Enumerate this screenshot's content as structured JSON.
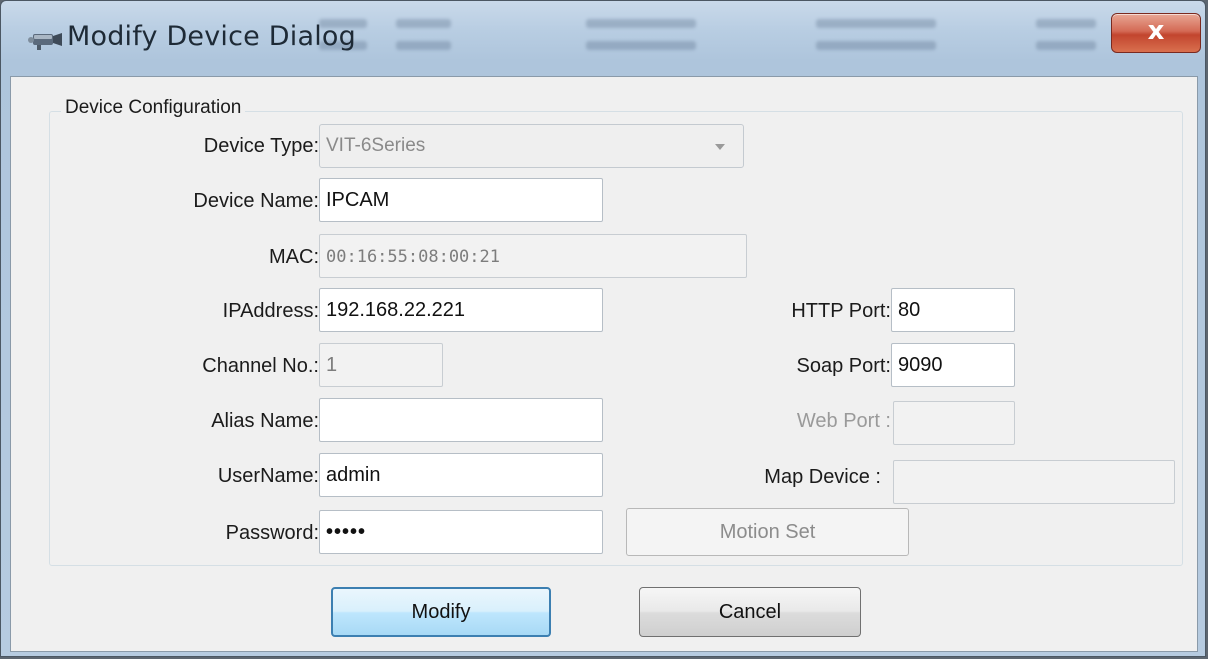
{
  "dialog": {
    "title": "Modify Device Dialog",
    "close_glyph": "x"
  },
  "group": {
    "title": "Device Configuration"
  },
  "fields": {
    "device_type": {
      "label": "Device Type:",
      "value": "VIT-6Series"
    },
    "device_name": {
      "label": "Device Name:",
      "value": "IPCAM"
    },
    "mac": {
      "label": "MAC:",
      "value": "00:16:55:08:00:21"
    },
    "ip_address": {
      "label": "IPAddress:",
      "value": "192.168.22.221"
    },
    "channel_no": {
      "label": "Channel No.:",
      "value": "1"
    },
    "alias_name": {
      "label": "Alias Name:",
      "value": ""
    },
    "username": {
      "label": "UserName:",
      "value": "admin"
    },
    "password": {
      "label": "Password:",
      "value": "•••••"
    },
    "http_port": {
      "label": "HTTP Port:",
      "value": "80"
    },
    "soap_port": {
      "label": "Soap Port:",
      "value": "9090"
    },
    "web_port": {
      "label": "Web Port :",
      "value": ""
    },
    "map_device": {
      "label": "Map Device :",
      "value": ""
    }
  },
  "buttons": {
    "motion_set": "Motion Set",
    "modify": "Modify",
    "cancel": "Cancel"
  },
  "colors": {
    "title_bar": "#b8cde2",
    "close_button": "#c2452e",
    "default_button_border": "#3c7fb1"
  }
}
